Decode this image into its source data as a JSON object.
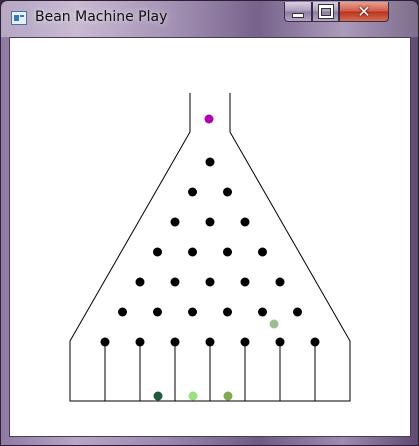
{
  "window": {
    "title": "Bean Machine Play",
    "icon": "app-window-icon",
    "controls": {
      "minimize": "minimize-icon",
      "maximize": "maximize-icon",
      "close_glyph": "✕"
    }
  },
  "board": {
    "peg_color": "#000000",
    "frame_color": "#000000",
    "peg_rows": 7,
    "slot_count": 8,
    "falling_ball": {
      "color": "#b000b0",
      "state": "in-chute"
    },
    "bouncing_ball": {
      "color": "#9ebc94",
      "state": "falling-between-pegs"
    },
    "landed_balls": [
      {
        "slot": 3,
        "color": "#1f5a3a"
      },
      {
        "slot": 4,
        "color": "#99e07f"
      },
      {
        "slot": 5,
        "color": "#7eac4d"
      }
    ]
  }
}
